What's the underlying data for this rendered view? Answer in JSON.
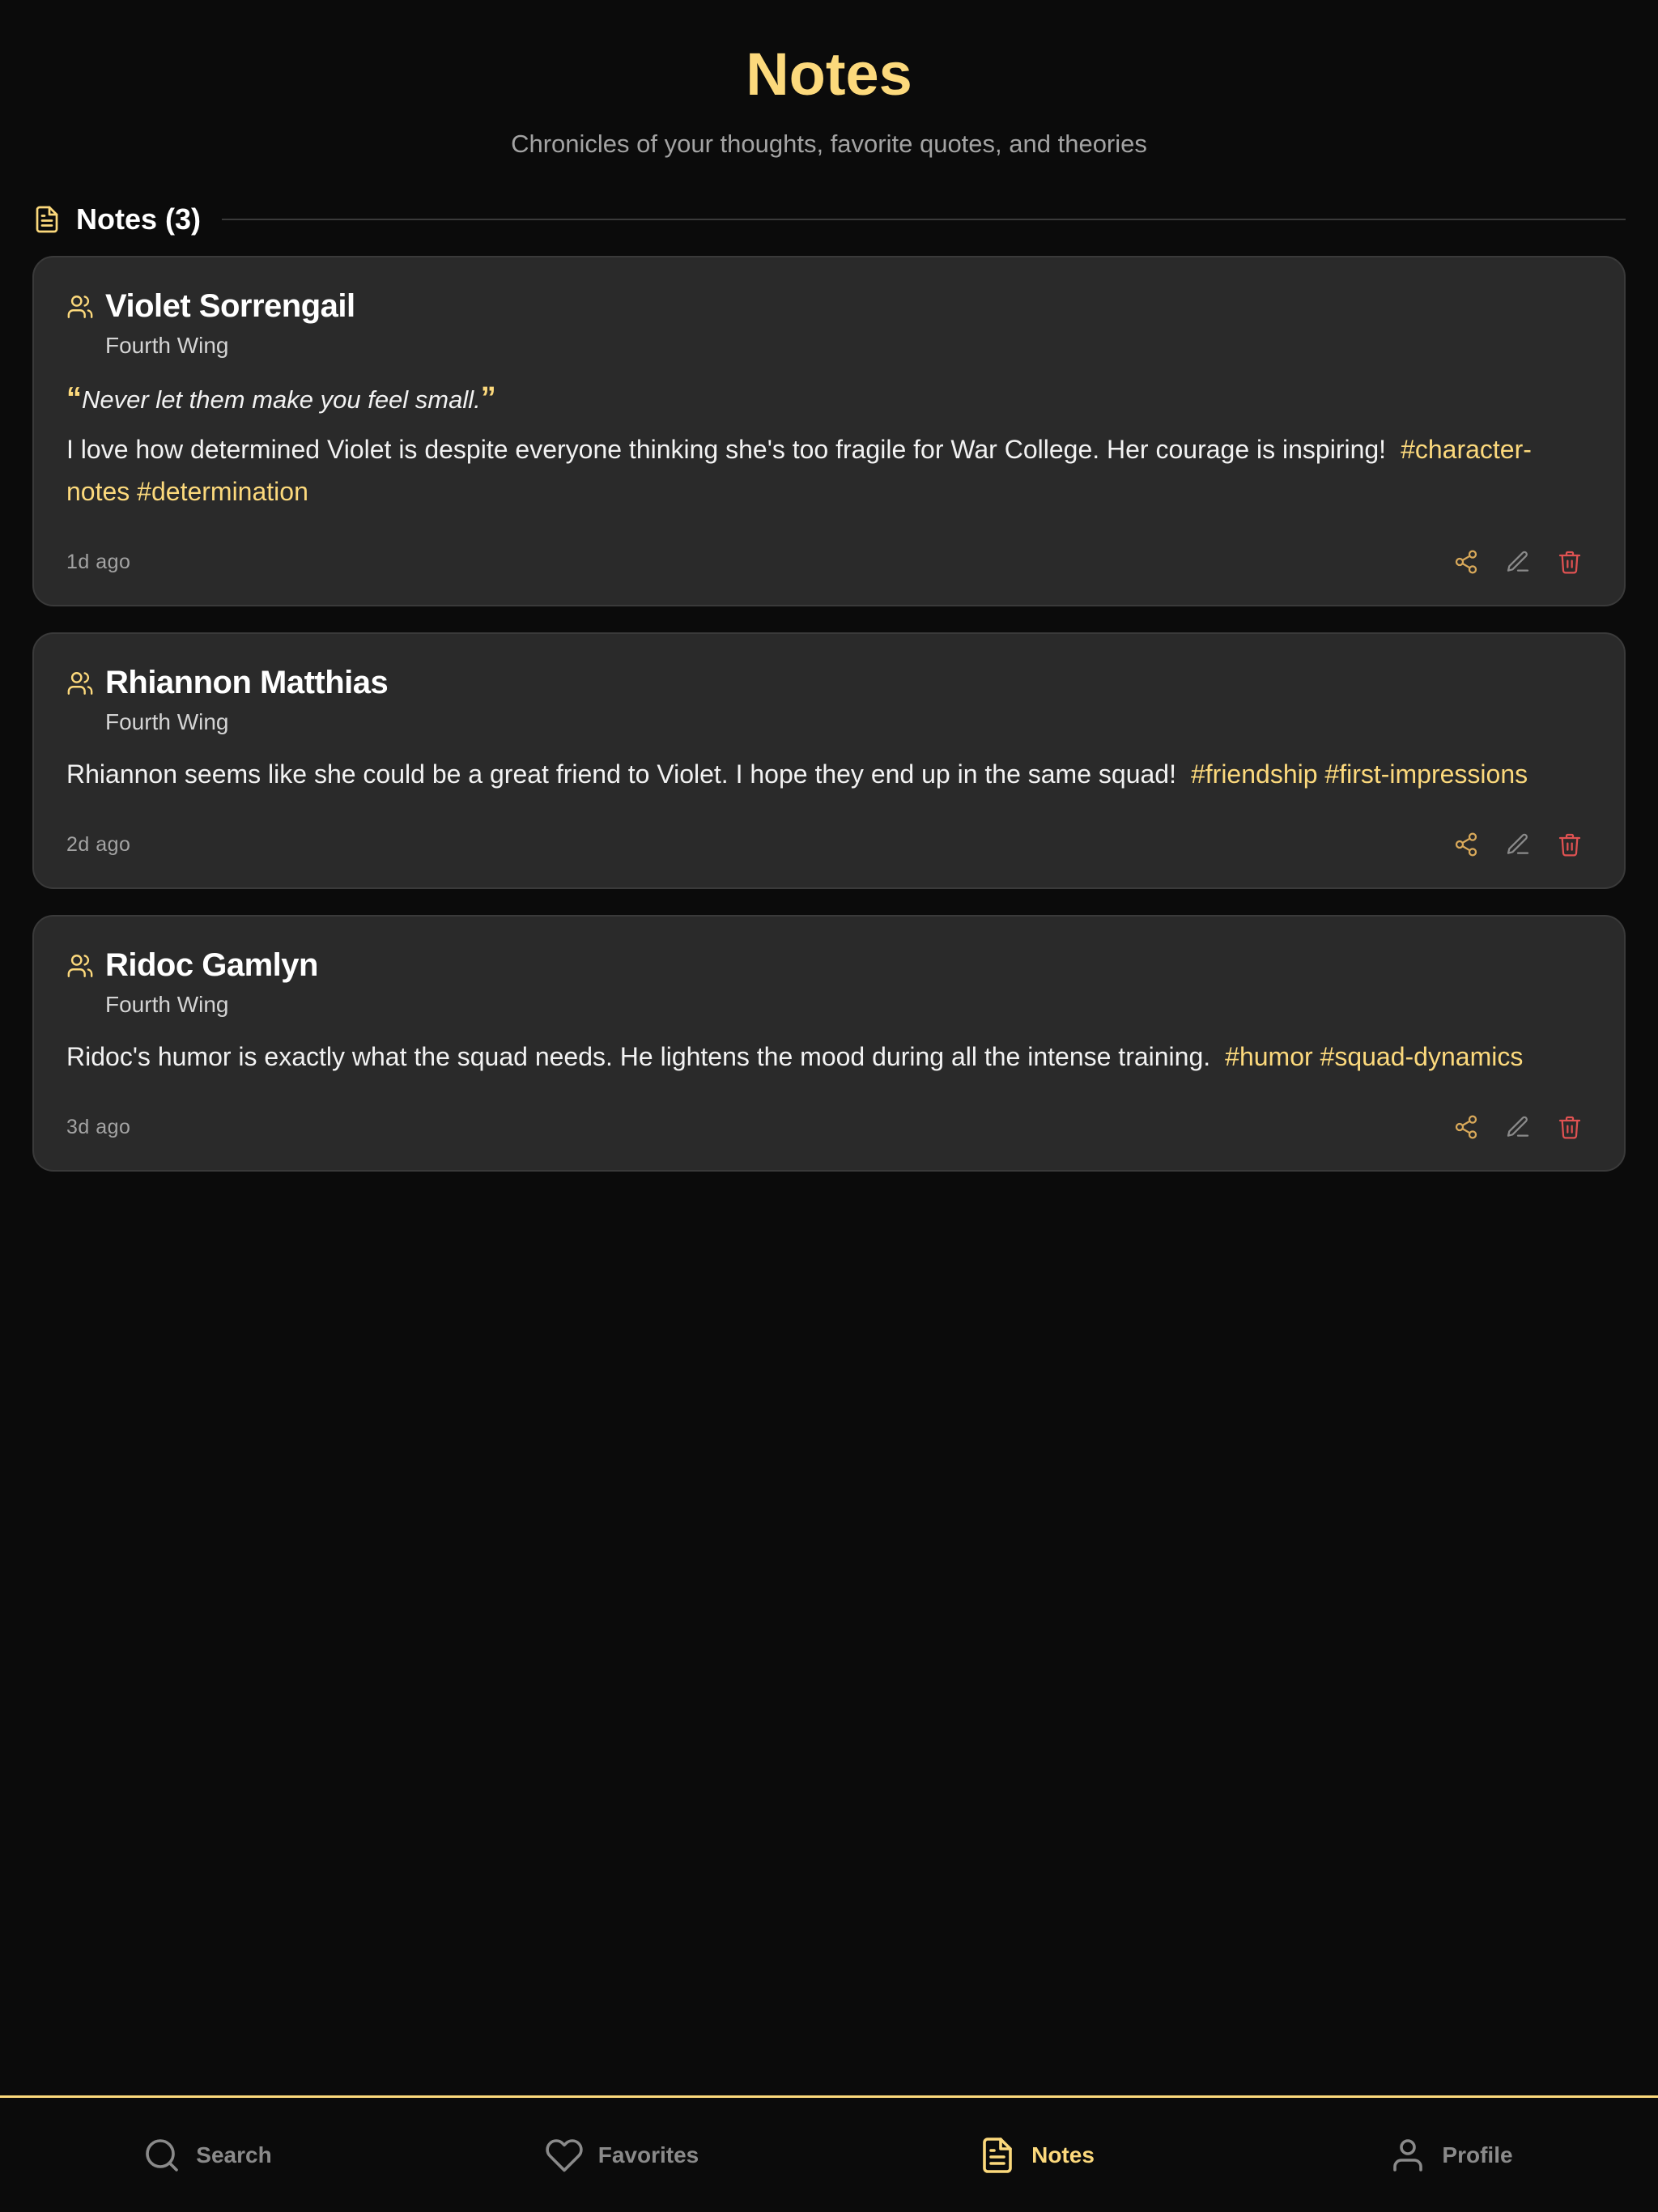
{
  "header": {
    "title": "Notes",
    "subtitle": "Chronicles of your thoughts, favorite quotes, and theories"
  },
  "section": {
    "icon": "document-icon",
    "title": "Notes (3)"
  },
  "notes": [
    {
      "icon": "users-icon",
      "name": "Violet Sorrengail",
      "book": "Fourth Wing",
      "quote": "Never let them make you feel small.",
      "quote_open": "“",
      "quote_close": "”",
      "body": "I love how determined Violet is despite everyone thinking she's too fragile for War College. Her courage is inspiring!",
      "tags": "#character-notes #determination",
      "time": "1d ago"
    },
    {
      "icon": "users-icon",
      "name": "Rhiannon Matthias",
      "book": "Fourth Wing",
      "quote": "",
      "body": "Rhiannon seems like she could be a great friend to Violet. I hope they end up in the same squad!",
      "tags": "#friendship #first-impressions",
      "time": "2d ago"
    },
    {
      "icon": "users-icon",
      "name": "Ridoc Gamlyn",
      "book": "Fourth Wing",
      "quote": "",
      "body": "Ridoc's humor is exactly what the squad needs. He lightens the mood during all the intense training.",
      "tags": "#humor #squad-dynamics",
      "time": "3d ago"
    }
  ],
  "actions": {
    "share_icon": "share-icon",
    "edit_icon": "pencil-icon",
    "delete_icon": "trash-icon"
  },
  "nav": {
    "items": [
      {
        "label": "Search",
        "icon": "search-icon",
        "active": false
      },
      {
        "label": "Favorites",
        "icon": "heart-icon",
        "active": false
      },
      {
        "label": "Notes",
        "icon": "document-icon",
        "active": true
      },
      {
        "label": "Profile",
        "icon": "user-icon",
        "active": false
      }
    ]
  },
  "colors": {
    "accent": "#fcd97c",
    "background": "#0b0b0b",
    "card": "#2a2a2a",
    "danger": "#e05252",
    "muted": "#8a8a8a"
  }
}
